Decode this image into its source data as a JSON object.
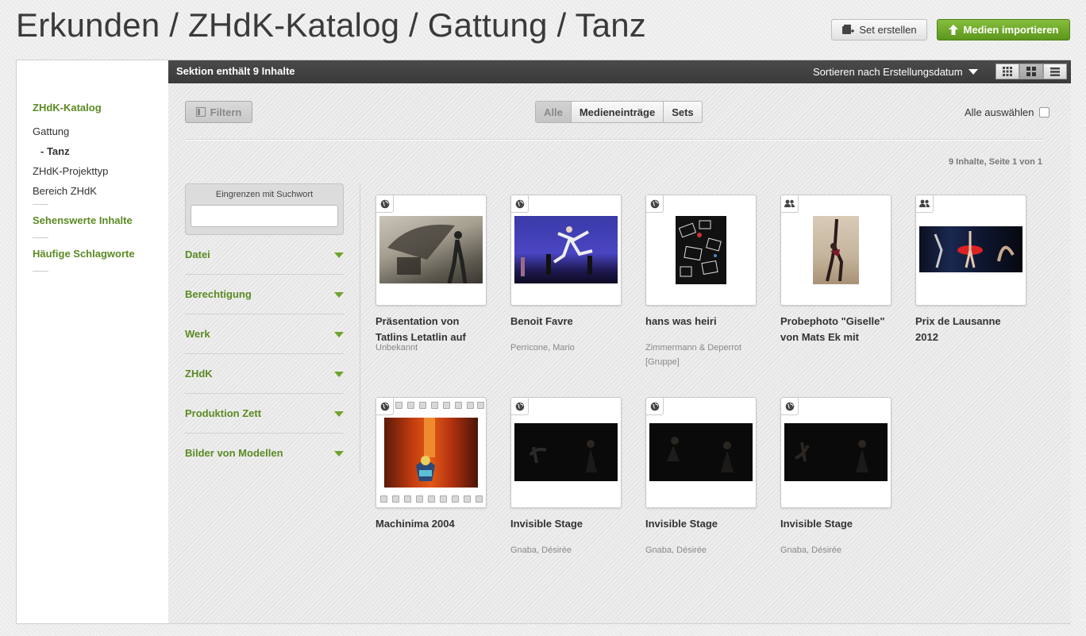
{
  "breadcrumb": "Erkunden / ZHdK-Katalog / Gattung / Tanz",
  "header": {
    "set_button": "Set erstellen",
    "import_button": "Medien importieren"
  },
  "sidebar": {
    "catalog": "ZHdK-Katalog",
    "items": [
      "Gattung",
      "- Tanz",
      "ZHdK-Projekttyp",
      "Bereich ZHdK"
    ],
    "sehenswert": "Sehenswerte Inhalte",
    "schlagworte": "Häufige Schlagworte"
  },
  "toolbar": {
    "count": "Sektion enthält 9 Inhalte",
    "sort": "Sortieren nach Erstellungsdatum",
    "filter": "Filtern",
    "tabs": [
      "Alle",
      "Medieneinträge",
      "Sets"
    ],
    "select_all": "Alle auswählen",
    "page_info": "9 Inhalte, Seite 1 von 1"
  },
  "filter": {
    "search_label": "Eingrenzen mit Suchwort",
    "facets": [
      "Datei",
      "Berechtigung",
      "Werk",
      "ZHdK",
      "Produktion Zett",
      "Bilder von Modellen"
    ]
  },
  "items": [
    {
      "title": "Präsentation von Tatlins Letatlin auf",
      "author": "Unbekannt",
      "badge": "globe-icon"
    },
    {
      "title": "Benoit Favre",
      "author": "Perricone, Mario",
      "badge": "globe-icon"
    },
    {
      "title": "hans was heiri",
      "author": "Zimmermann & Deperrot [Gruppe]",
      "badge": "globe-icon"
    },
    {
      "title": "Probephoto \"Giselle\" von Mats Ek mit Gözde",
      "author": "",
      "badge": "group-icon"
    },
    {
      "title": "Prix de Lausanne 2012",
      "author": "",
      "badge": "group-icon"
    },
    {
      "title": "Machinima 2004",
      "author": "",
      "badge": "globe-icon"
    },
    {
      "title": "Invisible Stage",
      "author": "Gnaba, Désirée",
      "badge": "globe-icon"
    },
    {
      "title": "Invisible Stage",
      "author": "Gnaba, Désirée",
      "badge": "globe-icon"
    },
    {
      "title": "Invisible Stage",
      "author": "Gnaba, Désirée",
      "badge": "globe-icon"
    }
  ]
}
